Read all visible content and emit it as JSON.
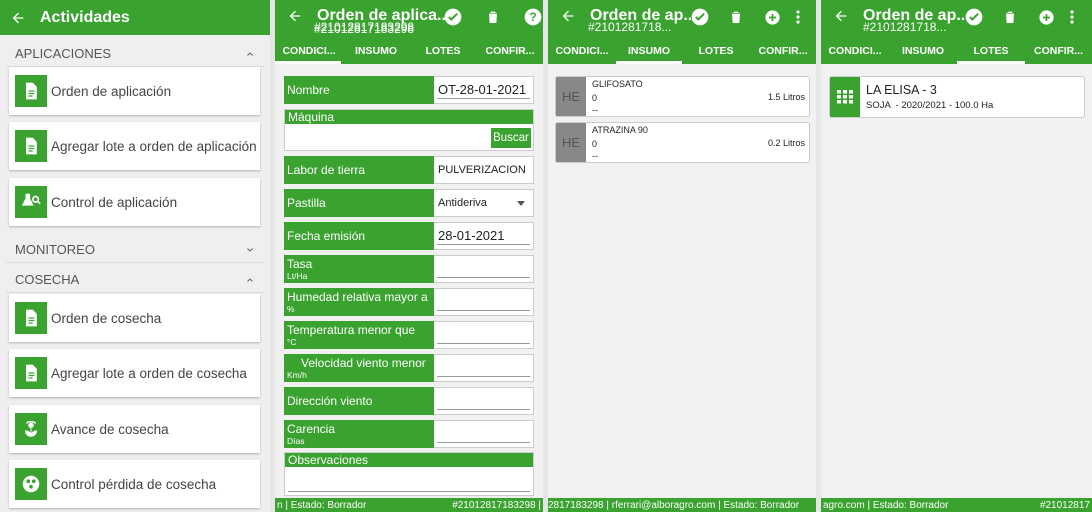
{
  "panel1": {
    "title": "Actividades",
    "sections": [
      {
        "label": "APLICACIONES",
        "expanded": true
      },
      {
        "label": "MONITOREO",
        "expanded": false
      },
      {
        "label": "COSECHA",
        "expanded": true
      }
    ],
    "cards": [
      {
        "label": "Orden de aplicación",
        "icon": "document-icon"
      },
      {
        "label": "Agregar lote a orden de aplicación",
        "icon": "document-icon"
      },
      {
        "label": "Control de aplicación",
        "icon": "flask-search-icon"
      },
      {
        "label": "Orden de cosecha",
        "icon": "document-icon"
      },
      {
        "label": "Agregar lote a orden de cosecha",
        "icon": "document-icon"
      },
      {
        "label": "Avance de cosecha",
        "icon": "plant-icon"
      },
      {
        "label": "Control pérdida de cosecha",
        "icon": "seeds-icon"
      }
    ]
  },
  "panel2": {
    "title": "Orden de aplica...",
    "subtitle": "#21012817183298",
    "tabs": [
      "CONDICI...",
      "INSUMO",
      "LOTES",
      "CONFIR..."
    ],
    "fields": {
      "nombre": {
        "label": "Nombre",
        "value": "OT-28-01-2021"
      },
      "maquina": {
        "label": "Máquina",
        "button": "Buscar"
      },
      "labor": {
        "label": "Labor de tierra",
        "value": "PULVERIZACION T"
      },
      "pastilla": {
        "label": "Pastilla",
        "value": "Antideriva"
      },
      "fecha": {
        "label": "Fecha emisión",
        "value": "28-01-2021"
      },
      "tasa": {
        "label": "Tasa",
        "unit": "Lt/Ha"
      },
      "humedad": {
        "label": "Humedad relativa mayor a",
        "unit": "%"
      },
      "temperatura": {
        "label": "Temperatura menor que",
        "unit": "°C"
      },
      "viento": {
        "label": "Velocidad viento menor",
        "unit": "Km/h"
      },
      "direccion": {
        "label": "Dirección viento"
      },
      "carencia": {
        "label": "Carencia",
        "unit": "Días"
      },
      "observaciones": {
        "label": "Observaciones"
      }
    },
    "footer_left": "n | Estado: Borrador",
    "footer_right": "#21012817183298 |"
  },
  "panel3": {
    "title": "Orden de ap...",
    "subtitle": "#2101281718...",
    "tabs": [
      "CONDICI...",
      "INSUMO",
      "LOTES",
      "CONFIR..."
    ],
    "items": [
      {
        "badge": "HE",
        "name": "GLIFOSATO",
        "qty": "0",
        "dash": "--",
        "amount": "1.5 Litros"
      },
      {
        "badge": "HE",
        "name": "ATRAZINA 90",
        "qty": "0",
        "dash": "--",
        "amount": "0.2 Litros"
      }
    ],
    "footer": "2817183298 | rferrari@alboragro.com | Estado: Borrador"
  },
  "panel4": {
    "title": "Orden de ap...",
    "subtitle": "#2101281718...",
    "tabs": [
      "CONDICI...",
      "INSUMO",
      "LOTES",
      "CONFIR..."
    ],
    "lote": {
      "name": "LA ELISA - 3",
      "detail": "SOJA  - 2020/2021 - 100.0 Ha"
    },
    "footer_left": "agro.com | Estado: Borrador",
    "footer_right": "#21012817"
  },
  "colors": {
    "accent": "#3aa32f",
    "background": "#efefef"
  }
}
